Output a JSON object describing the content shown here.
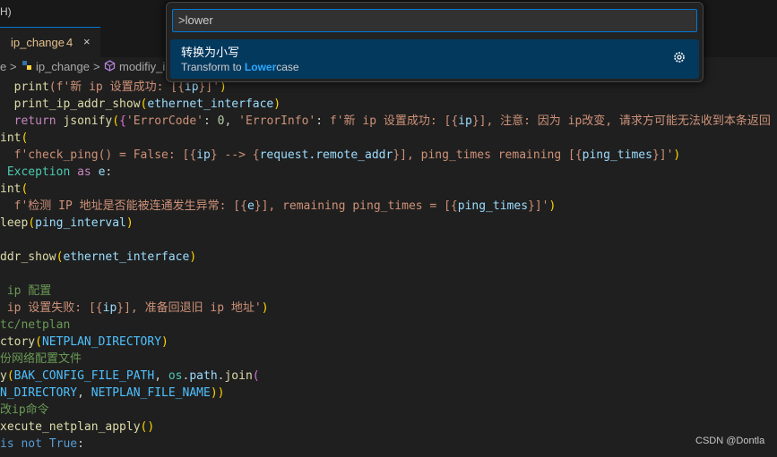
{
  "titlebar": {
    "menu_fragment": "H)"
  },
  "tab": {
    "label": "ip_change",
    "problem_count": "4",
    "close_glyph": "×"
  },
  "breadcrumb": {
    "sep1": "e >",
    "file": "ip_change",
    "sep2": ">",
    "symbol": "modifiy_i"
  },
  "quick_open": {
    "input_value": ">lower",
    "result": {
      "title": "转换为小写",
      "desc_before": "Transform to ",
      "desc_highlight": "Lower",
      "desc_after": "case",
      "gear_icon": "gear-icon"
    }
  },
  "code_lines": [
    [
      {
        "t": "  ",
        "c": "pl"
      },
      {
        "t": "print",
        "c": "fn"
      },
      {
        "t": "(f'新 ip 设置成功: [{",
        "c": "str"
      },
      {
        "t": "ip",
        "c": "var"
      },
      {
        "t": "}]'",
        "c": "str"
      },
      {
        "t": ")",
        "c": "br"
      }
    ],
    [
      {
        "t": "  ",
        "c": "pl"
      },
      {
        "t": "print_ip_addr_show",
        "c": "fn"
      },
      {
        "t": "(",
        "c": "br"
      },
      {
        "t": "ethernet_interface",
        "c": "var"
      },
      {
        "t": ")",
        "c": "br"
      }
    ],
    [
      {
        "t": "  ",
        "c": "pl"
      },
      {
        "t": "return ",
        "c": "kw"
      },
      {
        "t": "jsonify",
        "c": "fn"
      },
      {
        "t": "(",
        "c": "br"
      },
      {
        "t": "{",
        "c": "br2"
      },
      {
        "t": "'ErrorCode'",
        "c": "str"
      },
      {
        "t": ": ",
        "c": "pl"
      },
      {
        "t": "0",
        "c": "num"
      },
      {
        "t": ", ",
        "c": "pl"
      },
      {
        "t": "'ErrorInfo'",
        "c": "str"
      },
      {
        "t": ": ",
        "c": "pl"
      },
      {
        "t": "f'新 ip 设置成功: [{",
        "c": "str"
      },
      {
        "t": "ip",
        "c": "var"
      },
      {
        "t": "}], 注意: 因为 ip改变, 请求方可能无法收到本条返回",
        "c": "str"
      }
    ],
    [
      {
        "t": "int",
        "c": "fn"
      },
      {
        "t": "(",
        "c": "br"
      }
    ],
    [
      {
        "t": "  ",
        "c": "pl"
      },
      {
        "t": "f'check_ping() = False: [{",
        "c": "str"
      },
      {
        "t": "ip",
        "c": "var"
      },
      {
        "t": "} --> {",
        "c": "str"
      },
      {
        "t": "request.remote_addr",
        "c": "var"
      },
      {
        "t": "}], ping_times remaining [{",
        "c": "str"
      },
      {
        "t": "ping_times",
        "c": "var"
      },
      {
        "t": "}]'",
        "c": "str"
      },
      {
        "t": ")",
        "c": "br"
      }
    ],
    [
      {
        "t": " ",
        "c": "pl"
      },
      {
        "t": "Exception",
        "c": "cls"
      },
      {
        "t": " as ",
        "c": "kw"
      },
      {
        "t": "e",
        "c": "var"
      },
      {
        "t": ":",
        "c": "pl"
      }
    ],
    [
      {
        "t": "int",
        "c": "fn"
      },
      {
        "t": "(",
        "c": "br"
      }
    ],
    [
      {
        "t": "  ",
        "c": "pl"
      },
      {
        "t": "f'检测 IP 地址是否能被连通发生异常: [{",
        "c": "str"
      },
      {
        "t": "e",
        "c": "var"
      },
      {
        "t": "}], remaining ping_times = [{",
        "c": "str"
      },
      {
        "t": "ping_times",
        "c": "var"
      },
      {
        "t": "}]'",
        "c": "str"
      },
      {
        "t": ")",
        "c": "br"
      }
    ],
    [
      {
        "t": "leep",
        "c": "fn"
      },
      {
        "t": "(",
        "c": "br"
      },
      {
        "t": "ping_interval",
        "c": "var"
      },
      {
        "t": ")",
        "c": "br"
      }
    ],
    [],
    [
      {
        "t": "ddr_show",
        "c": "fn"
      },
      {
        "t": "(",
        "c": "br"
      },
      {
        "t": "ethernet_interface",
        "c": "var"
      },
      {
        "t": ")",
        "c": "br"
      }
    ],
    [],
    [
      {
        "t": " ip 配置",
        "c": "cmt"
      }
    ],
    [
      {
        "t": " ip 设置失败: [{",
        "c": "str"
      },
      {
        "t": "ip",
        "c": "var"
      },
      {
        "t": "}], 准备回退旧 ip 地址'",
        "c": "str"
      },
      {
        "t": ")",
        "c": "br"
      }
    ],
    [
      {
        "t": "tc/netplan",
        "c": "cmt"
      }
    ],
    [
      {
        "t": "ctory",
        "c": "fn"
      },
      {
        "t": "(",
        "c": "br"
      },
      {
        "t": "NETPLAN_DIRECTORY",
        "c": "con"
      },
      {
        "t": ")",
        "c": "br"
      }
    ],
    [
      {
        "t": "份网络配置文件",
        "c": "cmt"
      }
    ],
    [
      {
        "t": "y",
        "c": "fn"
      },
      {
        "t": "(",
        "c": "br"
      },
      {
        "t": "BAK_CONFIG_FILE_PATH",
        "c": "con"
      },
      {
        "t": ", ",
        "c": "pl"
      },
      {
        "t": "os",
        "c": "cls"
      },
      {
        "t": ".",
        "c": "pl"
      },
      {
        "t": "path",
        "c": "var"
      },
      {
        "t": ".",
        "c": "pl"
      },
      {
        "t": "join",
        "c": "fn"
      },
      {
        "t": "(",
        "c": "br2"
      }
    ],
    [
      {
        "t": "N_DIRECTORY",
        "c": "con"
      },
      {
        "t": ", ",
        "c": "pl"
      },
      {
        "t": "NETPLAN_FILE_NAME",
        "c": "con"
      },
      {
        "t": "))",
        "c": "br"
      }
    ],
    [
      {
        "t": "改ip命令",
        "c": "cmt"
      }
    ],
    [
      {
        "t": "xecute_netplan_apply",
        "c": "fn"
      },
      {
        "t": "()",
        "c": "br"
      }
    ],
    [
      {
        "t": "is ",
        "c": "kwb"
      },
      {
        "t": "not ",
        "c": "kwb"
      },
      {
        "t": "True",
        "c": "kwb"
      },
      {
        "t": ":",
        "c": "pl"
      }
    ]
  ],
  "watermark": "CSDN @Dontla"
}
